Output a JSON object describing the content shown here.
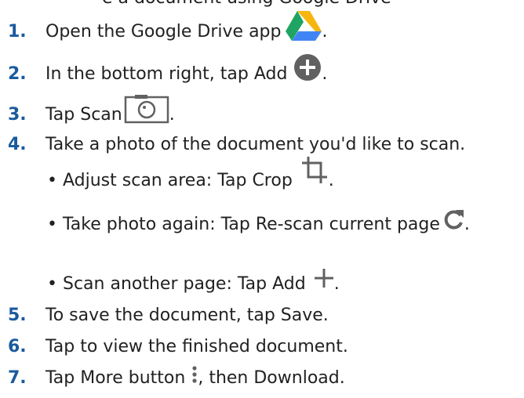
{
  "partial_heading": "e a document using Google Drive",
  "steps": [
    {
      "num": "1.",
      "before": "Open the Google Drive app",
      "icon": "google-drive-icon",
      "after": "."
    },
    {
      "num": "2.",
      "before": "In the bottom right, tap Add",
      "icon": "add-circle-icon",
      "after": "."
    },
    {
      "num": "3.",
      "before": "Tap Scan",
      "icon": "camera-icon",
      "after": "."
    },
    {
      "num": "4.",
      "before": "Take a photo of the document you'd like to scan.",
      "icon": "",
      "after": ""
    },
    {
      "num": "5.",
      "before": "To save the document, tap Save.",
      "icon": "",
      "after": ""
    },
    {
      "num": "6.",
      "before": "Tap to view the finished document.",
      "icon": "",
      "after": ""
    },
    {
      "num": "7.",
      "before": "Tap More button",
      "icon": "more-vert-icon",
      "after": ", then Download."
    }
  ],
  "substeps": [
    {
      "bullet": "•",
      "before": "Adjust scan area: Tap Crop",
      "icon": "crop-icon",
      "after": "."
    },
    {
      "bullet": "•",
      "before": "Take photo again: Tap Re-scan current page",
      "icon": "refresh-icon",
      "after": "."
    },
    {
      "bullet": "•",
      "before": "Scan another page: Tap Add",
      "icon": "plus-icon",
      "after": "."
    }
  ],
  "colors": {
    "number": "#1a5a9e",
    "text": "#212121",
    "icon_gray": "#616161"
  }
}
